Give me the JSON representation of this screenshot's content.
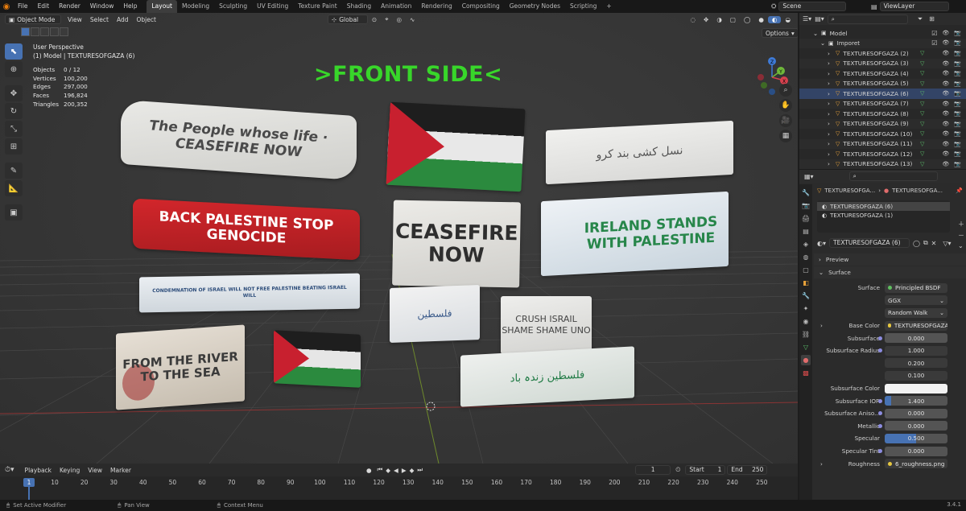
{
  "topbar": {
    "menus": [
      "File",
      "Edit",
      "Render",
      "Window",
      "Help"
    ],
    "workspaces": [
      "Layout",
      "Modeling",
      "Sculpting",
      "UV Editing",
      "Texture Paint",
      "Shading",
      "Animation",
      "Rendering",
      "Compositing",
      "Geometry Nodes",
      "Scripting"
    ],
    "active_workspace": "Layout",
    "add_tab": "+",
    "scene": "Scene",
    "view_layer": "ViewLayer"
  },
  "viewport": {
    "mode": "Object Mode",
    "menus": [
      "View",
      "Select",
      "Add",
      "Object"
    ],
    "transform_orientation": "Global",
    "options": "Options",
    "perspective": "User Perspective",
    "active": "(1) Model | TEXTURESOFGAZA (6)",
    "stats": [
      {
        "k": "Objects",
        "v": "0 / 12"
      },
      {
        "k": "Vertices",
        "v": "100,200"
      },
      {
        "k": "Edges",
        "v": "297,000"
      },
      {
        "k": "Faces",
        "v": "196,824"
      },
      {
        "k": "Triangles",
        "v": "200,352"
      }
    ],
    "title": ">FRONT SIDE<",
    "gizmo": {
      "z": "Z",
      "y": "Y",
      "x": "X"
    }
  },
  "banners": [
    {
      "id": "b1",
      "text": "The People whose life · CEASEFIRE NOW"
    },
    {
      "id": "b2",
      "text": ""
    },
    {
      "id": "b3",
      "text": "نسل کشی بند کرو"
    },
    {
      "id": "b4",
      "text": "BACK PALESTINE STOP GENOCIDE"
    },
    {
      "id": "b5",
      "text": "CEASEFIRE NOW"
    },
    {
      "id": "b6",
      "text": "IRELAND STANDS WITH PALESTINE"
    },
    {
      "id": "b7",
      "text": "CONDEMNATION OF ISRAEL WILL NOT FREE PALESTINE BEATING ISRAEL WILL"
    },
    {
      "id": "b8",
      "text": "فلسطین"
    },
    {
      "id": "b9",
      "text": "CRUSH ISRAIL SHAME SHAME UNO"
    },
    {
      "id": "b10",
      "text": "FROM THE RIVER TO THE SEA"
    },
    {
      "id": "b11",
      "text": ""
    },
    {
      "id": "b12",
      "text": "فلسطین زندہ باد"
    }
  ],
  "timeline": {
    "menus": [
      "Playback",
      "Keying",
      "View",
      "Marker"
    ],
    "current_frame": "1",
    "start_label": "Start",
    "start": "1",
    "end_label": "End",
    "end": "250",
    "ticks": [
      "10",
      "20",
      "30",
      "40",
      "50",
      "60",
      "70",
      "80",
      "90",
      "100",
      "110",
      "120",
      "130",
      "140",
      "150",
      "160",
      "170",
      "180",
      "190",
      "200",
      "210",
      "220",
      "230",
      "240",
      "250"
    ],
    "playhead": "1"
  },
  "statusbar": {
    "left": "Set Active Modifier",
    "middle": "Pan View",
    "right": "Context Menu",
    "version": "3.4.1"
  },
  "outliner": {
    "rows": [
      {
        "label": "Model",
        "indent": 1,
        "type": "collection"
      },
      {
        "label": "Imporet",
        "indent": 2,
        "type": "collection"
      },
      {
        "label": "TEXTURESOFGAZA (2)",
        "indent": 3,
        "type": "mesh"
      },
      {
        "label": "TEXTURESOFGAZA (3)",
        "indent": 3,
        "type": "mesh"
      },
      {
        "label": "TEXTURESOFGAZA (4)",
        "indent": 3,
        "type": "mesh"
      },
      {
        "label": "TEXTURESOFGAZA (5)",
        "indent": 3,
        "type": "mesh"
      },
      {
        "label": "TEXTURESOFGAZA (6)",
        "indent": 3,
        "type": "mesh"
      },
      {
        "label": "TEXTURESOFGAZA (7)",
        "indent": 3,
        "type": "mesh"
      },
      {
        "label": "TEXTURESOFGAZA (8)",
        "indent": 3,
        "type": "mesh"
      },
      {
        "label": "TEXTURESOFGAZA (9)",
        "indent": 3,
        "type": "mesh"
      },
      {
        "label": "TEXTURESOFGAZA (10)",
        "indent": 3,
        "type": "mesh"
      },
      {
        "label": "TEXTURESOFGAZA (11)",
        "indent": 3,
        "type": "mesh"
      },
      {
        "label": "TEXTURESOFGAZA (12)",
        "indent": 3,
        "type": "mesh"
      },
      {
        "label": "TEXTURESOFGAZA (13)",
        "indent": 3,
        "type": "mesh"
      }
    ]
  },
  "properties": {
    "breadcrumb_obj": "TEXTURESOFGA...",
    "breadcrumb_mat": "TEXTURESOFGA...",
    "slots": [
      "TEXTURESOFGAZA (6)",
      "TEXTURESOFGAZA (1)"
    ],
    "material_name": "TEXTURESOFGAZA (6)",
    "preview": "Preview",
    "surface_panel": "Surface",
    "rows": [
      {
        "label": "Surface",
        "value": "Principled BSDF",
        "kind": "link",
        "color": "#5fbf5f"
      },
      {
        "label": "",
        "value": "GGX",
        "kind": "dropdown"
      },
      {
        "label": "",
        "value": "Random Walk",
        "kind": "dropdown"
      },
      {
        "label": "Base Color",
        "value": "TEXTURESOFGAZA (6)...",
        "kind": "link",
        "color": "#e6c740"
      },
      {
        "label": "Subsurface",
        "value": "0.000",
        "kind": "num"
      },
      {
        "label": "Subsurface Radius",
        "value": "1.000",
        "kind": "num"
      },
      {
        "label": "",
        "value": "0.200",
        "kind": "num"
      },
      {
        "label": "",
        "value": "0.100",
        "kind": "num"
      },
      {
        "label": "Subsurface Color",
        "value": "",
        "kind": "color"
      },
      {
        "label": "Subsurface IOR",
        "value": "1.400",
        "kind": "num"
      },
      {
        "label": "Subsurface Aniso...",
        "value": "0.000",
        "kind": "num"
      },
      {
        "label": "Metallic",
        "value": "0.000",
        "kind": "num"
      },
      {
        "label": "Specular",
        "value": "0.500",
        "kind": "slider"
      },
      {
        "label": "Specular Tint",
        "value": "0.000",
        "kind": "num"
      },
      {
        "label": "Roughness",
        "value": "6_roughness.png",
        "kind": "link",
        "color": "#e6c740"
      }
    ],
    "specular_fill": 0.5,
    "subsurface_ior_fill": 0.1
  }
}
